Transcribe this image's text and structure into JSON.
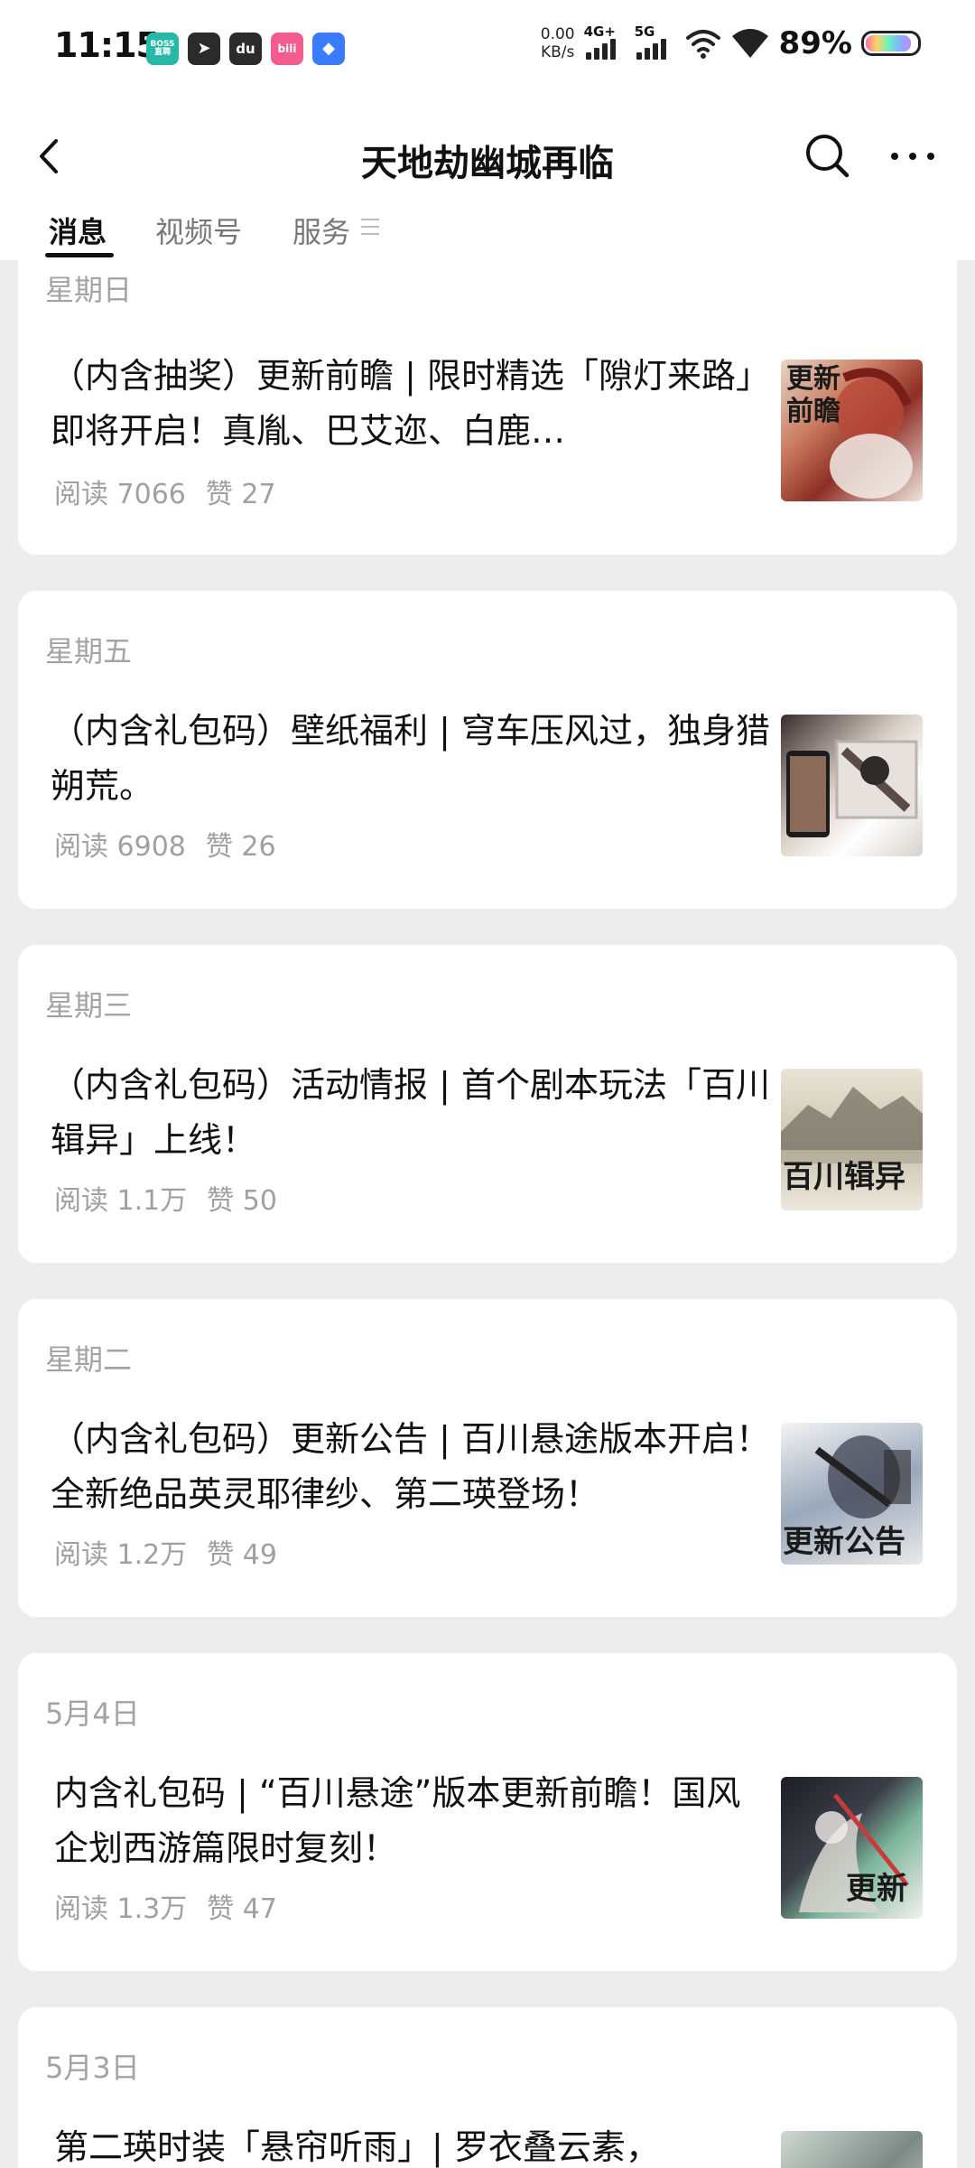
{
  "status_bar": {
    "time": "11:15",
    "apps": [
      {
        "name": "boss-zhipin",
        "label": "BOSS\n直聘",
        "color": "#28b8a8"
      },
      {
        "name": "telegram",
        "label": "➤",
        "color": "#2b2b2b"
      },
      {
        "name": "du",
        "label": "du",
        "color": "#2b2b2b"
      },
      {
        "name": "bilibili",
        "label": "bili",
        "color": "#f25d8e"
      },
      {
        "name": "blue-app",
        "label": "◆",
        "color": "#3a7bff"
      }
    ],
    "net_speed_value": "0.00",
    "net_speed_unit": "KB/s",
    "signal_4g": "4G+",
    "signal_5g": "5G",
    "battery": "89%",
    "battery_level": 0.89
  },
  "nav": {
    "title": "天地劫幽城再临",
    "back_icon": "chevron-left-icon",
    "search_icon": "search-icon",
    "more_icon": "more-icon"
  },
  "tabs": [
    {
      "label": "消息",
      "active": true
    },
    {
      "label": "视频号",
      "active": false
    },
    {
      "label": "服务",
      "active": false
    }
  ],
  "articles": [
    {
      "date": "星期日",
      "title": "（内含抽奖）更新前瞻 | 限时精选「隙灯来路」即将开启！真胤、巴艾迩、白鹿…",
      "reads": "阅读 7066",
      "likes": "赞 27",
      "thumb_text": "更新前瞻"
    },
    {
      "date": "星期五",
      "title": "（内含礼包码）壁纸福利 | 穹车压风过，独身猎朔荒。",
      "reads": "阅读 6908",
      "likes": "赞 26",
      "thumb_text": ""
    },
    {
      "date": "星期三",
      "title": "（内含礼包码）活动情报 | 首个剧本玩法「百川辑异」上线！",
      "reads": "阅读 1.1万",
      "likes": "赞 50",
      "thumb_text": "百川辑异"
    },
    {
      "date": "星期二",
      "title": "（内含礼包码）更新公告 | 百川悬途版本开启！全新绝品英灵耶律纱、第二瑛登场！",
      "reads": "阅读 1.2万",
      "likes": "赞 49",
      "thumb_text": "更新公告"
    },
    {
      "date": "5月4日",
      "title": "内含礼包码 | “百川悬途”版本更新前瞻！国风企划西游篇限时复刻！",
      "reads": "阅读 1.3万",
      "likes": "赞 47",
      "thumb_text": "更新"
    },
    {
      "date": "5月3日",
      "title": "第二瑛时装「悬帘听雨」| 罗衣叠云素，",
      "reads": "",
      "likes": "",
      "thumb_text": ""
    }
  ]
}
